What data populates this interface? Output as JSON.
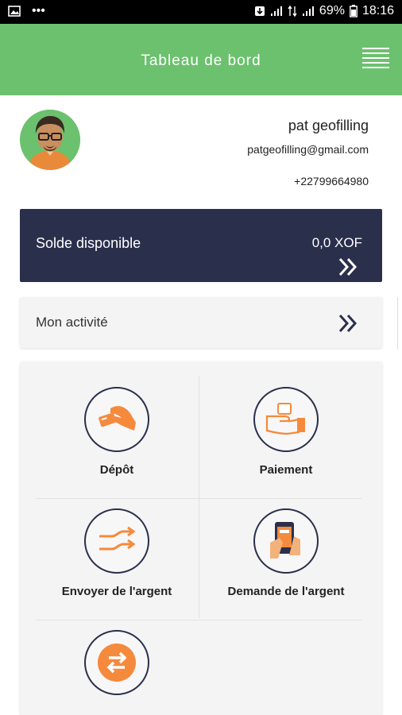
{
  "status_bar": {
    "battery": "69%",
    "time": "18:16"
  },
  "header": {
    "title": "Tableau de bord"
  },
  "profile": {
    "name": "pat geofilling",
    "email": "patgeofilling@gmail.com",
    "phone": "+22799664980"
  },
  "balance": {
    "label": "Solde disponible",
    "value": "0,0 XOF"
  },
  "activity": {
    "label": "Mon activité"
  },
  "services": [
    {
      "label": "Dépôt"
    },
    {
      "label": "Paiement"
    },
    {
      "label": "Envoyer de l'argent"
    },
    {
      "label": "Demande de l'argent"
    }
  ],
  "colors": {
    "header_green": "#6cc16e",
    "navy": "#2a2f4c",
    "accent_orange": "#f58a3c"
  }
}
